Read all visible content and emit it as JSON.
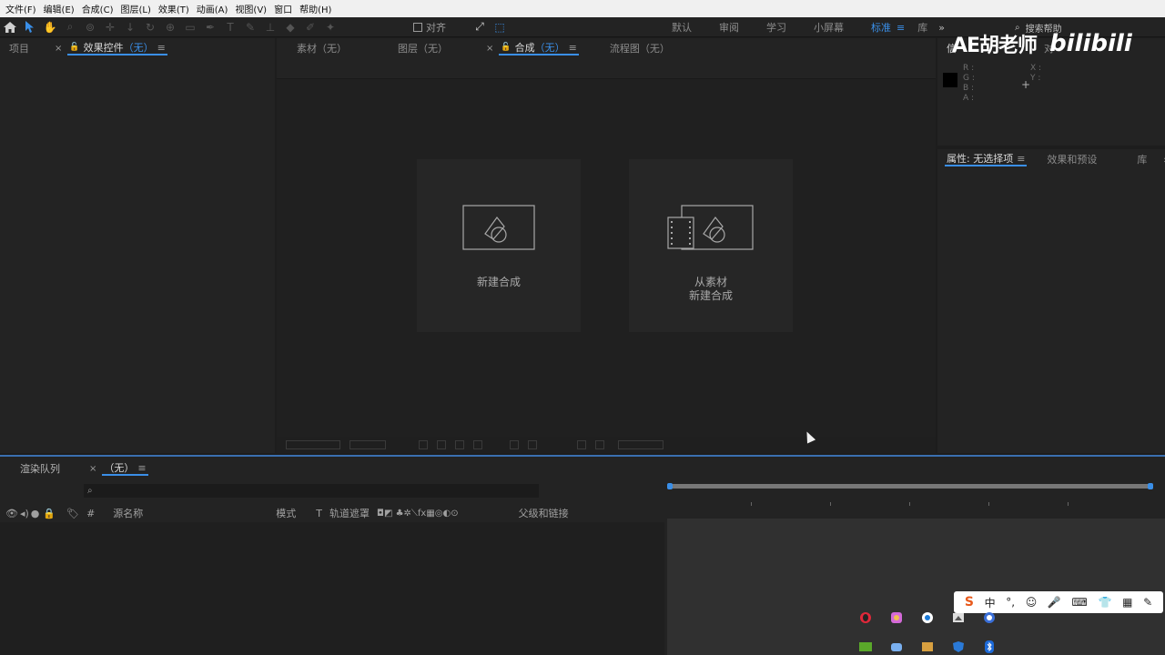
{
  "menubar": {
    "items": [
      "文件(F)",
      "编辑(E)",
      "合成(C)",
      "图层(L)",
      "效果(T)",
      "动画(A)",
      "视图(V)",
      "窗口",
      "帮助(H)"
    ]
  },
  "toolbar": {
    "snap_label": "对齐",
    "workspaces": [
      "默认",
      "审阅",
      "学习",
      "小屏幕",
      "标准",
      "库"
    ],
    "active_workspace": "标准",
    "search_help": "搜索帮助",
    "expand": "»"
  },
  "left_panel": {
    "tab_project": "项目",
    "tab_effects": "效果控件",
    "tab_effects_suffix": "（无）"
  },
  "comp_panel": {
    "tab_footage": "素材（无）",
    "tab_layer": "图层（无）",
    "tab_comp": "合成",
    "tab_comp_suffix": "（无）",
    "tab_flowchart": "流程图（无）",
    "card_new_comp": "新建合成",
    "card_from_footage_line1": "从素材",
    "card_from_footage_line2": "新建合成"
  },
  "watermark": {
    "left": "AE胡老师",
    "right": "bilibili"
  },
  "info_panel": {
    "tab_info": "信",
    "tab_audio": "对",
    "r": "R :",
    "g": "G :",
    "b": "B :",
    "a": "A :",
    "x": "X :",
    "y": "Y :"
  },
  "properties_panel": {
    "tab_properties": "属性: 无选择项",
    "tab_effects_presets": "效果和预设",
    "tab_library": "库",
    "expand": "»"
  },
  "timeline": {
    "tab_render_queue": "渲染队列",
    "tab_comp": "（无）",
    "search_icon": "⌕",
    "col_source_name": "源名称",
    "col_mode": "模式",
    "col_t": "T",
    "col_track_matte": "轨道遮罩",
    "col_parent": "父级和链接",
    "col_number": "#"
  },
  "ime": {
    "sogou": "S",
    "lang": "中",
    "punct": "°,",
    "emoji": "☺",
    "voice": "🎤",
    "keyboard": "⌨",
    "skin": "👕",
    "grid": "▦",
    "tool": "✎"
  },
  "colors": {
    "accent": "#3a8fe8",
    "panel_bg": "#232323",
    "menubar_bg": "#f0f0f0"
  }
}
